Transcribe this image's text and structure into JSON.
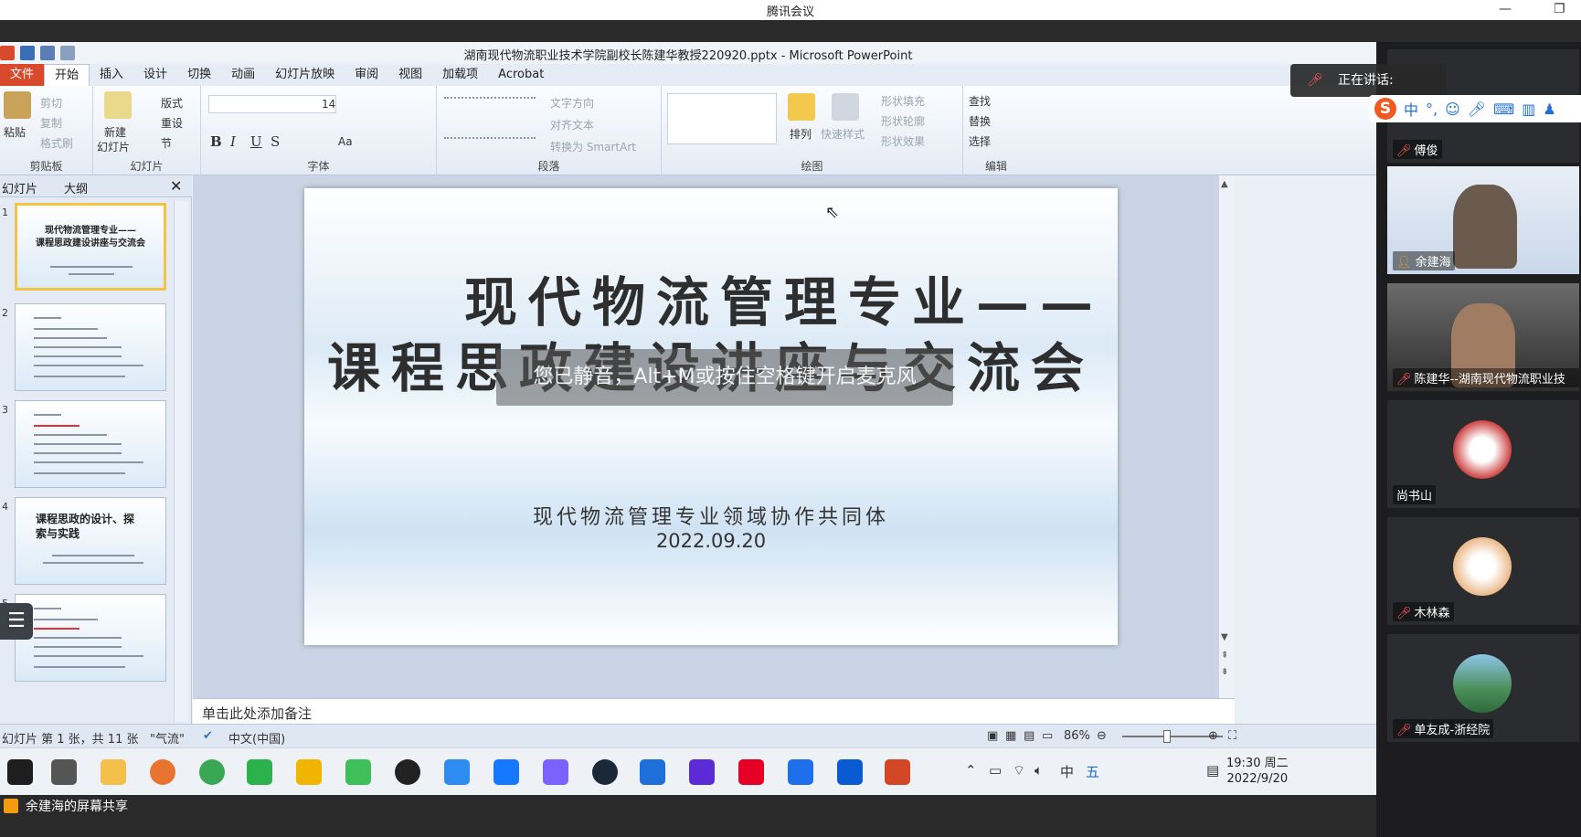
{
  "meeting": {
    "title": "腾讯会议",
    "minimize_icon": "minimize-icon",
    "restore_icon": "restore-icon",
    "speaking_label": "正在讲话:",
    "share_label": "余建海的屏幕共享"
  },
  "ppt": {
    "window_title": "湖南现代物流职业技术学院副校长陈建华教授220920.pptx - Microsoft PowerPoint",
    "tabs": [
      "文件",
      "开始",
      "插入",
      "设计",
      "切换",
      "动画",
      "幻灯片放映",
      "审阅",
      "视图",
      "加载项",
      "Acrobat"
    ],
    "ribbon": {
      "clipboard": {
        "paste": "粘贴",
        "cut": "剪切",
        "copy": "复制",
        "format_painter": "格式刷",
        "label": "剪贴板"
      },
      "slides": {
        "new_slide_1": "新建",
        "new_slide_2": "幻灯片",
        "layout": "版式",
        "reset": "重设",
        "section": "节",
        "label": "幻灯片"
      },
      "font": {
        "size": "14",
        "label": "字体",
        "bold": "B",
        "italic": "I",
        "underline": "U",
        "strike": "S",
        "aa": "Aa"
      },
      "paragraph": {
        "text_direction": "文字方向",
        "align_text": "对齐文本",
        "smartart": "转换为 SmartArt",
        "label": "段落"
      },
      "drawing": {
        "arrange": "排列",
        "quick_styles": "快速样式",
        "fill": "形状填充",
        "outline": "形状轮廓",
        "effects": "形状效果",
        "label": "绘图"
      },
      "editing": {
        "find": "查找",
        "replace": "替换",
        "select": "选择",
        "label": "编辑"
      }
    },
    "pane_tabs": {
      "slides": "幻灯片",
      "outline": "大纲"
    },
    "thumb_numbers": [
      "1",
      "2",
      "3",
      "4",
      "5"
    ],
    "thumb1": {
      "line1": "现代物流管理专业——",
      "line2": "课程思政建设讲座与交流会"
    },
    "thumb4": {
      "line1": "课程思政的设计、探",
      "line2": "索与实践"
    },
    "slide": {
      "title_line1": "现代物流管理专业——",
      "title_line2": "课程思政建设讲座与交流会",
      "subtitle": "现代物流管理专业领域协作共同体",
      "date": "2022.09.20"
    },
    "mute_toast": "您已静音，Alt+M或按住空格键开启麦克风",
    "notes_placeholder": "单击此处添加备注",
    "status": {
      "slide_info": "幻灯片 第 1 张，共 11 张",
      "theme": "\"气流\"",
      "language": "中文(中国)",
      "zoom": "86%"
    }
  },
  "taskbar": {
    "time": "19:30 周二",
    "date": "2022/9/20",
    "apps": [
      "start-icon",
      "task-view-icon",
      "file-explorer-icon",
      "browser-icon",
      "chrome-icon",
      "wechat-icon",
      "media-player-icon",
      "video-app-icon",
      "qq-icon",
      "security-app-icon",
      "app-icon",
      "network-app-icon",
      "steam-icon",
      "tencent-meeting-icon",
      "video-editor-icon",
      "netease-music-icon",
      "feishu-icon",
      "app-store-icon",
      "powerpoint-icon"
    ],
    "ime_indicator": "五"
  },
  "participants": [
    {
      "name": "傅俊",
      "kind": "camera-off"
    },
    {
      "name": "余建海",
      "kind": "video"
    },
    {
      "name": "陈建华--湖南现代物流职业技",
      "kind": "video"
    },
    {
      "name": "尚书山",
      "kind": "avatar",
      "color": "#c44"
    },
    {
      "name": "木林森",
      "kind": "avatar",
      "color": "#e8b07a"
    },
    {
      "name": "单友成-浙经院",
      "kind": "avatar",
      "color": "#4a8f5a"
    }
  ],
  "ime_bar": {
    "mode": "中",
    "punct": "°,"
  },
  "colors": {
    "file_tab": "#d9492c",
    "accent_blue": "#1e6fd9",
    "mic_off": "#ff5757",
    "thumb_select": "#f5c343"
  }
}
